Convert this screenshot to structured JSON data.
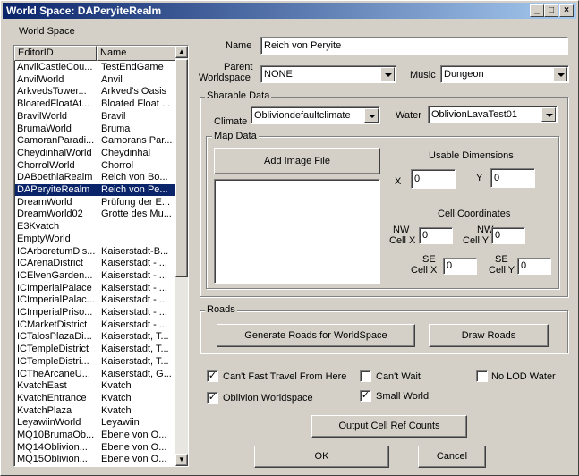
{
  "window": {
    "title": "World Space: DAPeryiteRealm"
  },
  "left": {
    "group_label": "World Space",
    "columns": [
      "EditorID",
      "Name"
    ],
    "rows": [
      [
        "AnvilCastleCou...",
        "TestEndGame"
      ],
      [
        "AnvilWorld",
        "Anvil"
      ],
      [
        "ArkvedsTower...",
        "Arkved's Oasis"
      ],
      [
        "BloatedFloatAt...",
        "Bloated Float ..."
      ],
      [
        "BravilWorld",
        "Bravil"
      ],
      [
        "BrumaWorld",
        "Bruma"
      ],
      [
        "CamoranParadi...",
        "Camorans Par..."
      ],
      [
        "CheydinhalWorld",
        "Cheydinhal"
      ],
      [
        "ChorrolWorld",
        "Chorrol"
      ],
      [
        "DABoethiaRealm",
        "Reich von Bo..."
      ],
      [
        "DAPeryiteRealm",
        "Reich von Pe..."
      ],
      [
        "DreamWorld",
        "Prüfung der E..."
      ],
      [
        "DreamWorld02",
        "Grotte des Mu..."
      ],
      [
        "E3Kvatch",
        ""
      ],
      [
        "EmptyWorld",
        ""
      ],
      [
        "ICArboretumDis...",
        "Kaiserstadt-B..."
      ],
      [
        "ICArenaDistrict",
        "Kaiserstadt - ..."
      ],
      [
        "ICElvenGarden...",
        "Kaiserstadt - ..."
      ],
      [
        "ICImperialPalace",
        "Kaiserstadt - ..."
      ],
      [
        "ICImperialPalac...",
        "Kaiserstadt - ..."
      ],
      [
        "ICImperialPriso...",
        "Kaiserstadt - ..."
      ],
      [
        "ICMarketDistrict",
        "Kaiserstadt - ..."
      ],
      [
        "ICTalosPlazaDi...",
        "Kaiserstadt, T..."
      ],
      [
        "ICTempleDistrict",
        "Kaiserstadt, T..."
      ],
      [
        "ICTempleDistri...",
        "Kaiserstadt, T..."
      ],
      [
        "ICTheArcaneU...",
        "Kaiserstadt, G..."
      ],
      [
        "KvatchEast",
        "Kvatch"
      ],
      [
        "KvatchEntrance",
        "Kvatch"
      ],
      [
        "KvatchPlaza",
        "Kvatch"
      ],
      [
        "LeyawiinWorld",
        "Leyawiin"
      ],
      [
        "MQ10BrumaOb...",
        "Ebene von O..."
      ],
      [
        "MQ14Oblivion...",
        "Ebene von O..."
      ],
      [
        "MQ15Oblivion...",
        "Ebene von O..."
      ]
    ],
    "selected_index": 10
  },
  "form": {
    "name_label": "Name",
    "name_value": "Reich von Peryite",
    "parent_label_1": "Parent",
    "parent_label_2": "Worldspace",
    "parent_value": "NONE",
    "music_label": "Music",
    "music_value": "Dungeon",
    "sharable_label": "Sharable Data",
    "climate_label": "Climate",
    "climate_value": "Obliviondefaultclimate",
    "water_label": "Water",
    "water_value": "OblivionLavaTest01",
    "map_label": "Map Data",
    "add_image_label": "Add Image File",
    "usable_dims_label": "Usable Dimensions",
    "x_label": "X",
    "x_value": "0",
    "y_label": "Y",
    "y_value": "0",
    "cell_coords_label": "Cell Coordinates",
    "nw": {
      "pre": "NW",
      "x_label": "Cell X",
      "x_value": "0",
      "y_label": "Cell Y",
      "y_value": "0"
    },
    "se": {
      "pre": "SE",
      "x_label": "Cell X",
      "x_value": "0",
      "y_label": "Cell Y",
      "y_value": "0"
    },
    "roads_label": "Roads",
    "generate_roads_label": "Generate Roads for WorldSpace",
    "draw_roads_label": "Draw Roads",
    "checks": {
      "cant_fast_travel": {
        "label": "Can't Fast Travel From Here",
        "checked": true
      },
      "cant_wait": {
        "label": "Can't Wait",
        "checked": false
      },
      "no_lod_water": {
        "label": "No LOD Water",
        "checked": false
      },
      "oblivion_worldspace": {
        "label": "Oblivion Worldspace",
        "checked": true
      },
      "small_world": {
        "label": "Small World",
        "checked": true
      }
    },
    "output_cell_ref_label": "Output Cell Ref Counts",
    "ok_label": "OK",
    "cancel_label": "Cancel"
  }
}
